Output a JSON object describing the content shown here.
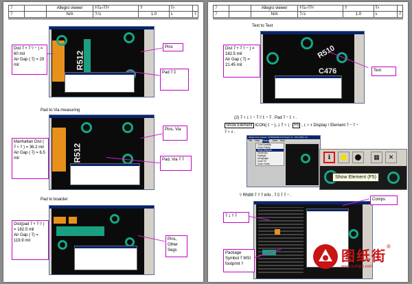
{
  "header_left": {
    "r1c1": "ﾌ",
    "r1c2": "",
    "r1c3": "Allegro viewer",
    "r1c4": "ｷﾏﾑｯﾏﾏｲ",
    "r1c5": "ｸ",
    "r1c6": "ﾏｯ",
    "r1c7": "",
    "r2c1": "ﾌ",
    "r2c2": "",
    "r2c3": "N/A",
    "r2c4": "ﾗﾉﾑ",
    "r2c5": "1.0",
    "r2c6": "ﾑ",
    "r2c7": "ﾏ"
  },
  "header_right": {
    "r1c1": "ﾌ",
    "r1c2": "",
    "r1c3": "Allegro viewer",
    "r1c4": "ｷﾏﾑｯﾏﾏｲ",
    "r1c5": "ｸ",
    "r1c6": "ﾏｯ",
    "r1c7": "",
    "r2c1": "ﾌ",
    "r2c2": "",
    "r2c3": "N/A",
    "r2c4": "ﾗﾉﾑ",
    "r2c5": "1.0",
    "r2c6": "ﾑ",
    "r2c7": "ﾏ"
  },
  "left": {
    "fig1": {
      "note": "Dist ﾏ ｬ ﾏ ﾘ ｰ ) = 60 mil\nAir Gap ( ﾏ) = 29 mil",
      "silk": "R512",
      "label_pins": "Pins",
      "label_pad": "Pad ﾏ ﾛ"
    },
    "caption2": "Pad to Via measuring",
    "fig2": {
      "note": "Manhattan Dist ( ﾏ ｯ ﾘ ) = 36.2 mil\nAir Gap ( ﾏ) = 6.5 mil",
      "silk": "R512",
      "label_pins": "Pins, Via",
      "label_pad": "Pad, Via ﾏ ﾏ"
    },
    "caption3": "Pad to boarder",
    "fig3": {
      "note": "Dist(pad ﾏ ｬ ﾏ ﾘ ) = 182.5 mil\nAir Gap ( ﾏ) = 119.9 mil",
      "label_pins": "Pins, Other Segs"
    }
  },
  "right": {
    "caption1": "Text to Text",
    "fig1": {
      "note": "Dist ﾏ ｬ ﾏ ﾘ ｰ ) = 182.5 mil\nAir Gap ( ﾏ) = 21.45 mil",
      "silk1": "R510",
      "silk2": "C476",
      "label_text": "Text"
    },
    "step2a": "(2) ﾏ ｯ ｪ ﾐ ｰ ﾏ ﾘ ﾋ ｰ ﾏ . Pad ﾏ ｰ ﾋ ｯ .",
    "step2b_highlight": "Show Element",
    "step2b_rest": "ICON( ﾋ ｰ ), ｪ ﾏ ｯ ｪ",
    "f5": "F5",
    "step2c": ", ｪ ｯ ｫ Display \\ Element ﾏ ｰ ﾘ ｰ",
    "step2d": "ﾏ ｯ ｫ .",
    "menu_title": "Allegro Free Viewer: 107D010ISR.brd Project: D - Allo 04/5(ﾐ 2) ﾐ",
    "menu_bar": [
      "File",
      "View",
      "Display",
      "Tools",
      "Help"
    ],
    "menu_items": [
      "Color/Visibility",
      "Color Priority",
      "Show Element",
      "Dimension",
      "Highlight",
      "Dehighlight",
      "Zoom Fit",
      "Zoom Points"
    ],
    "tooltip": "Show Element (F5)",
    "step3": "ﾘ  RN89 ﾏ ﾘ ﾏ info . ﾏ ﾛ ﾏ ﾏ ｰ .",
    "fig3": {
      "label_comps": "Comps",
      "note_left": "ﾏ ｪ ﾘ ﾏ",
      "note_pkg": "Package Symbol ﾏ MSI footprint ﾘ"
    }
  },
  "watermark": {
    "brand": "图纸街",
    "url": "www.tuzhijie.com",
    "reg": "®"
  }
}
